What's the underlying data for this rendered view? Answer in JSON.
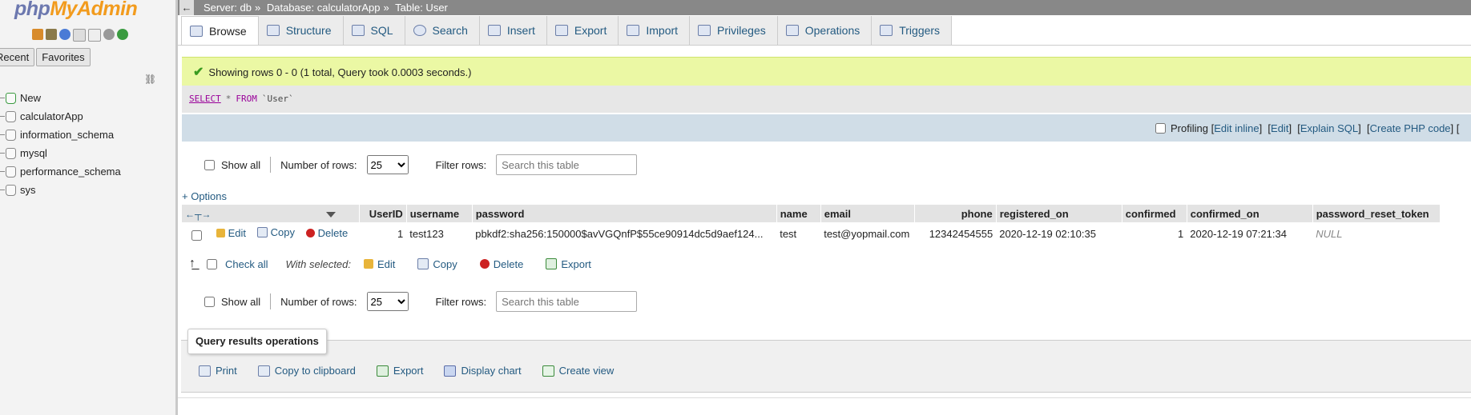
{
  "nav": {
    "logo_php": "php",
    "logo_myadmin": "MyAdmin",
    "icon_names": [
      "home-icon",
      "database-icon",
      "help-icon",
      "docs-icon",
      "page-icon",
      "settings-icon",
      "reload-icon"
    ],
    "tabs": [
      "Recent",
      "Favorites"
    ],
    "databases": [
      "New",
      "calculatorApp",
      "information_schema",
      "mysql",
      "performance_schema",
      "sys"
    ]
  },
  "breadcrumb": {
    "server": "Server: db",
    "database": "Database: calculatorApp",
    "table": "Table: User",
    "sep": "»"
  },
  "tabs": [
    "Browse",
    "Structure",
    "SQL",
    "Search",
    "Insert",
    "Export",
    "Import",
    "Privileges",
    "Operations",
    "Triggers"
  ],
  "message": "Showing rows 0 - 0 (1 total, Query took 0.0003 seconds.)",
  "sql": {
    "select": "SELECT",
    "star": "*",
    "from": "FROM",
    "table": "`User`"
  },
  "profiling": {
    "label": "Profiling",
    "links": [
      "Edit inline",
      "Edit",
      "Explain SQL",
      "Create PHP code"
    ]
  },
  "navigation": {
    "show_all": "Show all",
    "rows_label": "Number of rows:",
    "rows_value": "25",
    "filter_label": "Filter rows:",
    "filter_placeholder": "Search this table"
  },
  "options_label": "+ Options",
  "table": {
    "columns": [
      "UserID",
      "username",
      "password",
      "name",
      "email",
      "phone",
      "registered_on",
      "confirmed",
      "confirmed_on",
      "password_reset_token"
    ],
    "row_actions": [
      "Edit",
      "Copy",
      "Delete"
    ],
    "rows": [
      {
        "UserID": "1",
        "username": "test123",
        "password": "pbkdf2:sha256:150000$avVGQnfP$55ce90914dc5d9aef124...",
        "name": "test",
        "email": "test@yopmail.com",
        "phone": "12342454555",
        "registered_on": "2020-12-19 02:10:35",
        "confirmed": "1",
        "confirmed_on": "2020-12-19 07:21:34",
        "password_reset_token": "NULL"
      }
    ]
  },
  "with_selected": {
    "check_all": "Check all",
    "label": "With selected:",
    "actions": [
      "Edit",
      "Copy",
      "Delete",
      "Export"
    ]
  },
  "query_ops": {
    "legend": "Query results operations",
    "actions": [
      "Print",
      "Copy to clipboard",
      "Export",
      "Display chart",
      "Create view"
    ]
  },
  "colors": {
    "link": "#235a81",
    "success_bg": "#ebf8a4",
    "sql_keyword": "#990099",
    "header_bg": "#e3e3e3",
    "delete": "#cc2222"
  }
}
